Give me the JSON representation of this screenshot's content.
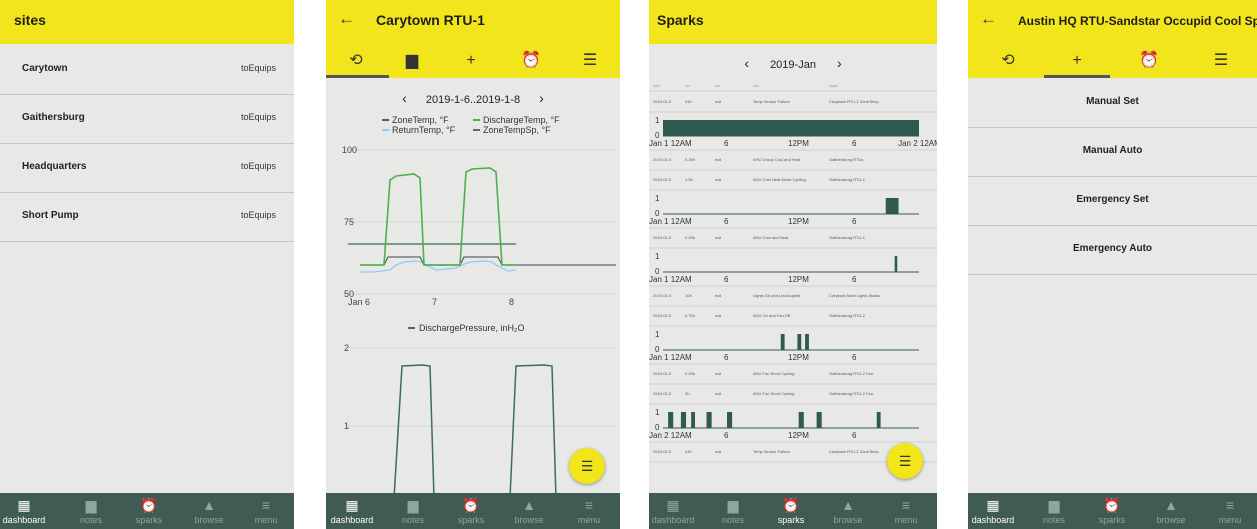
{
  "screens": {
    "sites": {
      "title": "sites",
      "rows": [
        {
          "name": "Carytown",
          "action": "toEquips"
        },
        {
          "name": "Gaithersburg",
          "action": "toEquips"
        },
        {
          "name": "Headquarters",
          "action": "toEquips"
        },
        {
          "name": "Short Pump",
          "action": "toEquips"
        }
      ],
      "active_nav": "dashboard"
    },
    "history": {
      "title": "Carytown RTU-1",
      "back": "←",
      "tabs": [
        "history-icon",
        "notes-icon",
        "add-icon",
        "alarm-icon",
        "list-icon"
      ],
      "active_tab": 0,
      "date_range": "2019-1-6..2019-1-8",
      "prev": "‹",
      "next": "›",
      "legend1": [
        "ZoneTemp, °F",
        "DischargeTemp, °F",
        "ReturnTemp, °F",
        "ZoneTempSp, °F"
      ],
      "legend2": "DischargePressure, inH₂O",
      "y1_ticks": [
        "100",
        "75",
        "50"
      ],
      "x1_ticks": [
        "Jan 6",
        "7",
        "8"
      ],
      "y2_ticks": [
        "2",
        "1"
      ],
      "active_nav": "dashboard"
    },
    "sparks": {
      "title": "Sparks",
      "month": "2019-Jan",
      "prev": "‹",
      "next": "›",
      "spark_rows": [
        {
          "date": "2019-01-0",
          "dur": "24h",
          "site": "null",
          "rule": "Temp Sensor Failure",
          "target": "Carytown RTU-1 ZoneTemp"
        },
        {
          "date": "2019-01-0",
          "dur": "0.25h",
          "site": "null",
          "rule": "AHU Group Cool and Heat",
          "target": "Gaithersburg RTUs"
        },
        {
          "date": "2019-01-0",
          "dur": "1.0h",
          "site": "null",
          "rule": "AHU Cool Heat Mode Cycling",
          "target": "Gaithersburg RTU-1"
        },
        {
          "date": "2019-01-0",
          "dur": "0.25h",
          "site": "null",
          "rule": "AHU Cool and Heat",
          "target": "Gaithersburg RTU-1"
        },
        {
          "date": "2019-01-0",
          "dur": "10h",
          "site": "null",
          "rule": "Lights On and Unoccupied",
          "target": "Carytown Main Lights Status"
        },
        {
          "date": "2019-01-0",
          "dur": "0.75h",
          "site": "null",
          "rule": "AHU On and Fan Off",
          "target": "Gaithersburg RTU-2"
        },
        {
          "date": "2019-01-0",
          "dur": "0.25h",
          "site": "null",
          "rule": "AHU Fan Short Cycling",
          "target": "Gaithersburg RTU-2 Fan"
        },
        {
          "date": "2019-01-0",
          "dur": "2h",
          "site": "null",
          "rule": "AHU Fan Short Cycling",
          "target": "Gaithersburg RTU-2 Fan"
        },
        {
          "date": "2019-01-0",
          "dur": "24h",
          "site": "null",
          "rule": "Temp Sensor Failure",
          "target": "Carytown RTU-1 ZoneTemp"
        }
      ],
      "axis1": [
        "Jan 1 12AM",
        "6",
        "12PM",
        "6",
        "Jan 2 12AM"
      ],
      "axis": [
        "Jan 1 12AM",
        "6",
        "12PM",
        "6"
      ],
      "axis_last": [
        "Jan 2 12AM",
        "6",
        "12PM",
        "6"
      ],
      "y_one": "1",
      "y_zero": "0",
      "active_nav": "sparks"
    },
    "manual": {
      "title": "Austin HQ RTU-Sandstar Occupid Cool Sp",
      "back": "←",
      "tabs": [
        "history-icon",
        "add-icon",
        "alarm-icon",
        "list-icon"
      ],
      "active_tab": 1,
      "options": [
        "Manual Set",
        "Manual Auto",
        "Emergency Set",
        "Emergency Auto"
      ],
      "active_nav": "dashboard"
    }
  },
  "nav": [
    "dashboard",
    "notes",
    "sparks",
    "browse",
    "menu"
  ],
  "nav_icons": [
    "dashboard-icon",
    "notes-icon",
    "alarm-clock-icon",
    "navigation-icon",
    "menu-icon"
  ],
  "colors": {
    "appbar": "#f3e51b",
    "background": "#e8e9e7",
    "navbar": "#3f5b54",
    "spark_bar": "#2f5a51",
    "zone_temp": "#3d6b5c",
    "discharge_temp": "#4caf50",
    "return_temp": "#90caf9",
    "zone_temp_sp": "#666666"
  }
}
